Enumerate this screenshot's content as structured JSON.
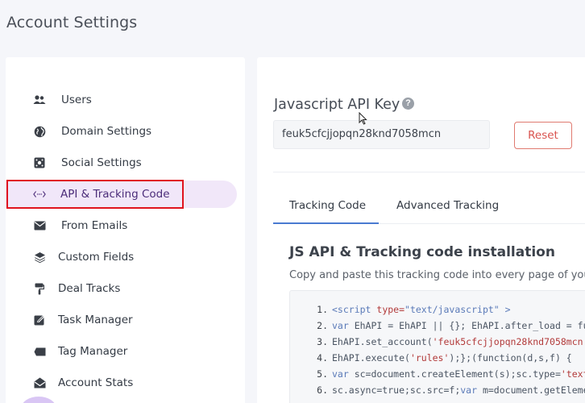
{
  "page": {
    "title": "Account Settings"
  },
  "sidebar": {
    "items": [
      {
        "label": "Users",
        "icon": "users-icon"
      },
      {
        "label": "Domain Settings",
        "icon": "globe-icon"
      },
      {
        "label": "Social Settings",
        "icon": "social-icon"
      },
      {
        "label": "API & Tracking Code",
        "icon": "code-icon",
        "active": true
      },
      {
        "label": "From Emails",
        "icon": "envelope-icon"
      },
      {
        "label": "Custom Fields",
        "icon": "layers-icon"
      },
      {
        "label": "Deal Tracks",
        "icon": "paint-roller-icon"
      },
      {
        "label": "Task Manager",
        "icon": "edit-icon"
      },
      {
        "label": "Tag Manager",
        "icon": "tag-icon"
      },
      {
        "label": "Account Stats",
        "icon": "envelope-open-icon"
      }
    ]
  },
  "api": {
    "title": "Javascript API Key",
    "help": "?",
    "key": "feuk5cfcjjopqn28knd7058mcn",
    "reset_label": "Reset"
  },
  "tabs": [
    {
      "label": "Tracking Code",
      "active": true
    },
    {
      "label": "Advanced Tracking",
      "active": false
    }
  ],
  "install": {
    "title": "JS API & Tracking code installation",
    "description": "Copy and paste this tracking code into every page of your"
  },
  "code": {
    "numbers": [
      "1.",
      "2.",
      "3.",
      "4.",
      "5.",
      "6."
    ],
    "line1": {
      "a": "<script ",
      "b": "type=",
      "c": "\"text/javascript\"",
      "d": " >"
    },
    "line2": {
      "a": "var ",
      "b": "EhAPI = EhAPI || {}; EhAPI.after_load = fun"
    },
    "line3": {
      "a": "EhAPI.set_account(",
      "b": "'feuk5cfcjjopqn28knd7058mcn'",
      "c": ","
    },
    "line4": {
      "a": "EhAPI.execute(",
      "b": "'rules'",
      "c": ");};(function(d,s,f) {"
    },
    "line5": {
      "a": "var ",
      "b": "sc=document.createElement(s);sc.type=",
      "c": "'text/"
    },
    "line6": {
      "a": "sc.async=true;sc.src=f;",
      "b": "var ",
      "c": "m=document.getElemen"
    }
  },
  "colors": {
    "accent": "#4a7bd1",
    "active_bg": "#f1e7f9",
    "highlight": "#e0141e",
    "reset": "#d9534f"
  }
}
